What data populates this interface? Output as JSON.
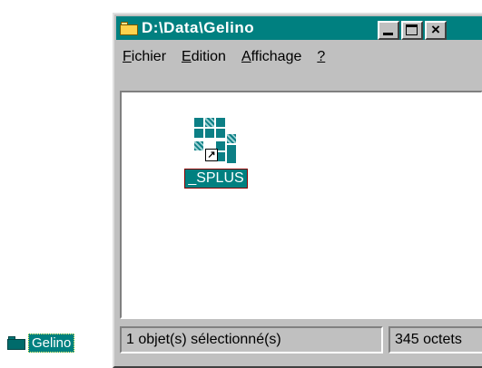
{
  "desktop": {
    "shortcut_label": "Gelino",
    "icon": "folder-icon"
  },
  "window": {
    "title": "D:\\Data\\Gelino",
    "title_icon": "open-folder-icon",
    "controls": {
      "minimize": "minimize-icon",
      "maximize": "maximize-icon",
      "close": "×"
    }
  },
  "menu": {
    "items": [
      {
        "accel": "F",
        "rest": "ichier"
      },
      {
        "accel": "E",
        "rest": "dition"
      },
      {
        "accel": "A",
        "rest": "ffichage"
      },
      {
        "accel": "?",
        "rest": ""
      }
    ]
  },
  "content": {
    "items": [
      {
        "label": "_SPLUS",
        "icon": "splus-shortcut-icon",
        "selected": true,
        "shortcut_glyph": "↗"
      }
    ]
  },
  "status": {
    "left": "1 objet(s) sélectionné(s)",
    "right": "345 octets"
  },
  "colors": {
    "titlebar": "#008080",
    "face": "#c0c0c0",
    "selection": "#008080",
    "icon_teal": "#0c7f85"
  }
}
